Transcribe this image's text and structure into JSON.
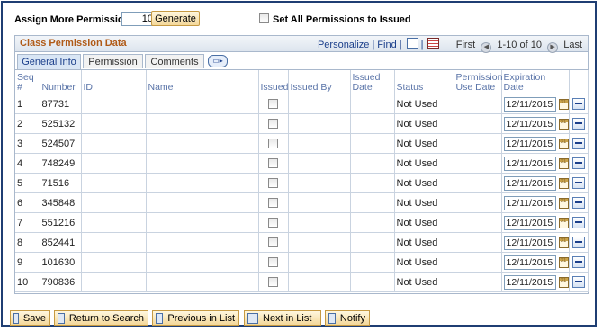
{
  "assign": {
    "label": "Assign More Permissions:",
    "value": "10",
    "generate_label": "Generate"
  },
  "set_all": {
    "label": "Set All Permissions to Issued"
  },
  "grid": {
    "title": "Class Permission Data",
    "personalize": "Personalize",
    "find": "Find",
    "first": "First",
    "range": "1-10 of 10",
    "last": "Last",
    "tabs": [
      "General Info",
      "Permission",
      "Comments"
    ],
    "columns": {
      "seq": "Seq #",
      "number": "Number",
      "id": "ID",
      "name": "Name",
      "issued": "Issued",
      "issued_by": "Issued By",
      "issued_date": "Issued Date",
      "status": "Status",
      "perm_use_date": "Permission Use Date",
      "exp_date": "Expiration Date"
    },
    "rows": [
      {
        "seq": "1",
        "number": "87731",
        "id": "",
        "name": "",
        "issued_by": "",
        "issued_date": "",
        "status": "Not Used",
        "perm_use_date": "",
        "exp_date": "12/11/2015"
      },
      {
        "seq": "2",
        "number": "525132",
        "id": "",
        "name": "",
        "issued_by": "",
        "issued_date": "",
        "status": "Not Used",
        "perm_use_date": "",
        "exp_date": "12/11/2015"
      },
      {
        "seq": "3",
        "number": "524507",
        "id": "",
        "name": "",
        "issued_by": "",
        "issued_date": "",
        "status": "Not Used",
        "perm_use_date": "",
        "exp_date": "12/11/2015"
      },
      {
        "seq": "4",
        "number": "748249",
        "id": "",
        "name": "",
        "issued_by": "",
        "issued_date": "",
        "status": "Not Used",
        "perm_use_date": "",
        "exp_date": "12/11/2015"
      },
      {
        "seq": "5",
        "number": "71516",
        "id": "",
        "name": "",
        "issued_by": "",
        "issued_date": "",
        "status": "Not Used",
        "perm_use_date": "",
        "exp_date": "12/11/2015"
      },
      {
        "seq": "6",
        "number": "345848",
        "id": "",
        "name": "",
        "issued_by": "",
        "issued_date": "",
        "status": "Not Used",
        "perm_use_date": "",
        "exp_date": "12/11/2015"
      },
      {
        "seq": "7",
        "number": "551216",
        "id": "",
        "name": "",
        "issued_by": "",
        "issued_date": "",
        "status": "Not Used",
        "perm_use_date": "",
        "exp_date": "12/11/2015"
      },
      {
        "seq": "8",
        "number": "852441",
        "id": "",
        "name": "",
        "issued_by": "",
        "issued_date": "",
        "status": "Not Used",
        "perm_use_date": "",
        "exp_date": "12/11/2015"
      },
      {
        "seq": "9",
        "number": "101630",
        "id": "",
        "name": "",
        "issued_by": "",
        "issued_date": "",
        "status": "Not Used",
        "perm_use_date": "",
        "exp_date": "12/11/2015"
      },
      {
        "seq": "10",
        "number": "790836",
        "id": "",
        "name": "",
        "issued_by": "",
        "issued_date": "",
        "status": "Not Used",
        "perm_use_date": "",
        "exp_date": "12/11/2015"
      }
    ]
  },
  "footer": {
    "save": "Save",
    "return_to_search": "Return to Search",
    "previous_in_list": "Previous in List",
    "next_in_list": "Next in List",
    "notify": "Notify"
  },
  "colors": {
    "frame": "#1f3e73",
    "title": "#b05a17",
    "link": "#1b3f8b",
    "header_text": "#5a74a8"
  }
}
